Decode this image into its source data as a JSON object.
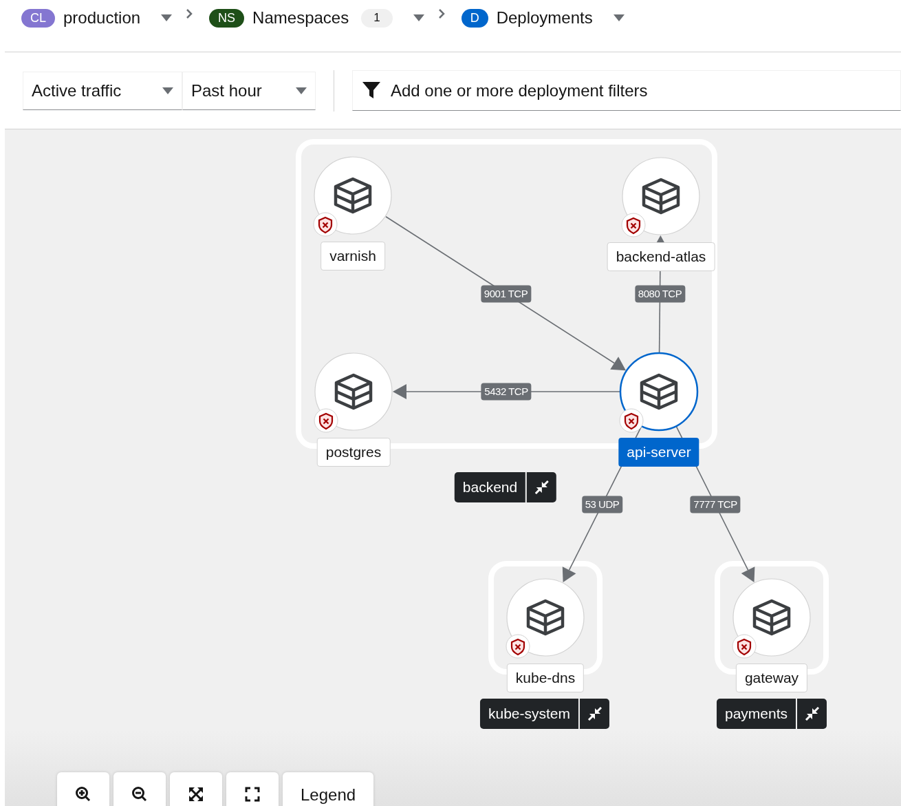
{
  "breadcrumbs": [
    {
      "badge": "CL",
      "color": "#8476d1",
      "label": "production"
    },
    {
      "badge": "NS",
      "color": "#1e4f18",
      "label": "Namespaces",
      "count": "1"
    },
    {
      "badge": "D",
      "color": "#0066cc",
      "label": "Deployments"
    }
  ],
  "toolbar": {
    "traffic_select": "Active traffic",
    "time_select": "Past hour",
    "filter": {
      "placeholder": "Add one or more deployment filters"
    }
  },
  "graph": {
    "groups": [
      {
        "label": "backend"
      },
      {
        "label": "kube-system"
      },
      {
        "label": "payments"
      }
    ],
    "nodes": [
      {
        "name": "varnish",
        "selected": false
      },
      {
        "name": "backend-atlas",
        "selected": false
      },
      {
        "name": "postgres",
        "selected": false
      },
      {
        "name": "api-server",
        "selected": true
      },
      {
        "name": "kube-dns",
        "selected": false
      },
      {
        "name": "gateway",
        "selected": false
      }
    ],
    "edges": [
      {
        "label": "9001 TCP"
      },
      {
        "label": "8080 TCP"
      },
      {
        "label": "5432 TCP"
      },
      {
        "label": "53 UDP"
      },
      {
        "label": "7777 TCP"
      }
    ]
  },
  "controls": [
    {
      "kind": "zoom-in"
    },
    {
      "kind": "zoom-out"
    },
    {
      "kind": "fit"
    },
    {
      "kind": "reset"
    },
    {
      "kind": "legend",
      "label": "Legend"
    }
  ]
}
